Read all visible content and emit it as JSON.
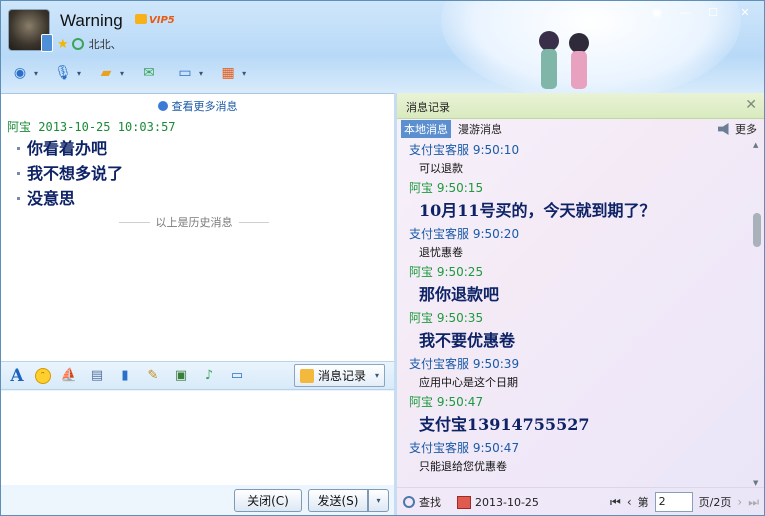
{
  "header": {
    "nickname": "Warning",
    "vip_label": "VIP5",
    "signature": "北北、",
    "controls": [
      "▣",
      "—",
      "☐",
      "✕"
    ]
  },
  "toolbar": {
    "buttons": [
      {
        "name": "video-call",
        "icon": "webcam-icon",
        "color": "#2a6fc9"
      },
      {
        "name": "voice-call",
        "icon": "microphone-icon",
        "color": "#2a6fc9"
      },
      {
        "name": "send-file",
        "icon": "folder-icon",
        "color": "#e8a21d"
      },
      {
        "name": "send-sms",
        "icon": "sms-icon",
        "color": "#3aa55a"
      },
      {
        "name": "remote-assist",
        "icon": "screen-icon",
        "color": "#2a6fc9"
      },
      {
        "name": "apps",
        "icon": "app-grid-icon",
        "color": "#e85a12"
      }
    ]
  },
  "chat": {
    "more_history": "查看更多消息",
    "sender": "阿宝",
    "timestamp": "2013-10-25 10:03:57",
    "messages": [
      "你看着办吧",
      "我不想多说了",
      "没意思"
    ],
    "history_separator": "以上是历史消息"
  },
  "format_bar": {
    "font_icon": "A",
    "history_button": "消息记录"
  },
  "actions": {
    "close": "关闭(C)",
    "send": "发送(S)",
    "send_arrow": "▾"
  },
  "history_panel": {
    "title": "消息记录",
    "close": "✕",
    "tabs": [
      "本地消息",
      "漫游消息"
    ],
    "more": "更多",
    "entries": [
      {
        "meta": "支付宝客服 9:50:10",
        "kind": "svc",
        "text": "可以退款",
        "big": false
      },
      {
        "meta": "阿宝 9:50:15",
        "kind": "ab",
        "text": "10月11号买的，今天就到期了？",
        "big": true
      },
      {
        "meta": "支付宝客服 9:50:20",
        "kind": "svc",
        "text": "退忧惠卷",
        "big": false
      },
      {
        "meta": "阿宝 9:50:25",
        "kind": "ab",
        "text": "那你退款吧",
        "big": true
      },
      {
        "meta": "阿宝 9:50:35",
        "kind": "ab",
        "text": "我不要优惠卷",
        "big": true
      },
      {
        "meta": "支付宝客服 9:50:39",
        "kind": "svc",
        "text": "应用中心是这个日期",
        "big": false
      },
      {
        "meta": "阿宝 9:50:47",
        "kind": "ab",
        "text": "支付宝13914755527",
        "big": true
      },
      {
        "meta": "支付宝客服 9:50:47",
        "kind": "svc",
        "text": "只能退给您优惠卷",
        "big": false
      }
    ],
    "footer": {
      "search": "查找",
      "date": "2013-10-25",
      "page_prefix": "第",
      "page_value": "2",
      "page_suffix": "页/2页"
    }
  }
}
